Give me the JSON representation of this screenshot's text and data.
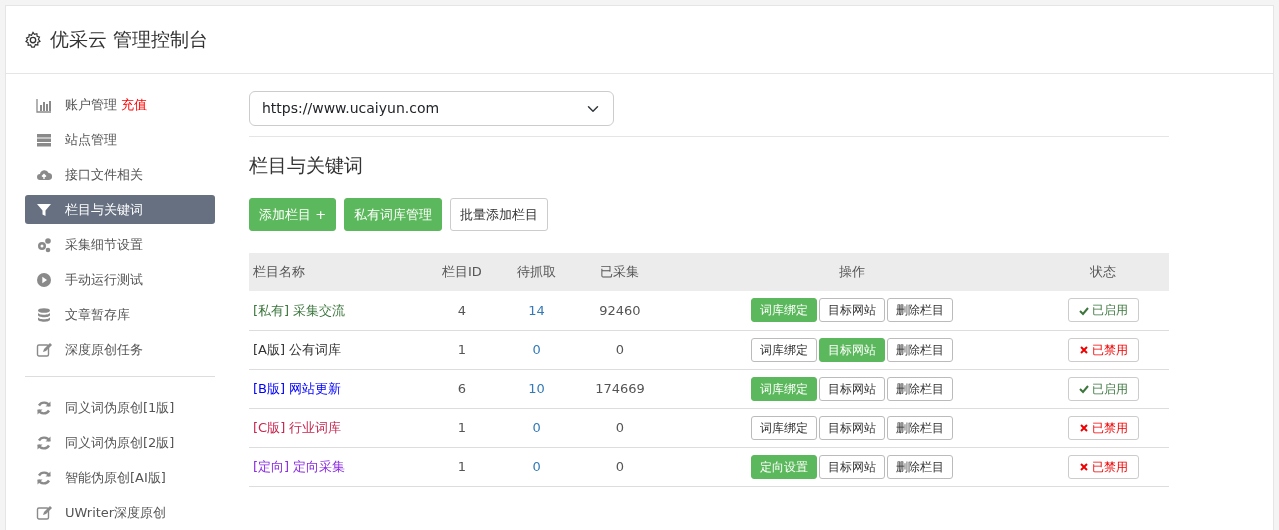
{
  "header": {
    "title": "优采云 管理控制台"
  },
  "sidebar": {
    "groups": [
      [
        {
          "label": "账户管理",
          "badge": "充值",
          "selected": false
        },
        {
          "label": "站点管理",
          "selected": false
        },
        {
          "label": "接口文件相关",
          "selected": false
        },
        {
          "label": "栏目与关键词",
          "selected": true
        },
        {
          "label": "采集细节设置",
          "selected": false
        },
        {
          "label": "手动运行测试",
          "selected": false
        },
        {
          "label": "文章暂存库",
          "selected": false
        },
        {
          "label": "深度原创任务",
          "selected": false
        }
      ],
      [
        {
          "label": "同义词伪原创[1版]",
          "selected": false
        },
        {
          "label": "同义词伪原创[2版]",
          "selected": false
        },
        {
          "label": "智能伪原创[AI版]",
          "selected": false
        },
        {
          "label": "UWriter深度原创",
          "selected": false
        }
      ]
    ]
  },
  "site_select": {
    "value": "https://www.ucaiyun.com"
  },
  "section_title": "栏目与关键词",
  "toolbar": [
    {
      "label": "添加栏目 +",
      "primary": true
    },
    {
      "label": "私有词库管理",
      "primary": true
    },
    {
      "label": "批量添加栏目",
      "primary": false
    }
  ],
  "table": {
    "columns": [
      "栏目名称",
      "栏目ID",
      "待抓取",
      "已采集",
      "操作",
      "状态"
    ],
    "rows": [
      {
        "tag": "[私有]",
        "name": "采集交流",
        "color": "#3c763d",
        "id": "4",
        "pending": "14",
        "collected": "92460",
        "actions": [
          {
            "label": "词库绑定",
            "selected": true
          },
          {
            "label": "目标网站",
            "selected": false
          },
          {
            "label": "删除栏目",
            "selected": false
          }
        ],
        "status": {
          "label": "已启用",
          "enabled": true
        }
      },
      {
        "tag": "[A版]",
        "name": "公有词库",
        "color": "#333333",
        "id": "1",
        "pending": "0",
        "collected": "0",
        "actions": [
          {
            "label": "词库绑定",
            "selected": false
          },
          {
            "label": "目标网站",
            "selected": true
          },
          {
            "label": "删除栏目",
            "selected": false
          }
        ],
        "status": {
          "label": "已禁用",
          "enabled": false
        }
      },
      {
        "tag": "[B版]",
        "name": "网站更新",
        "color": "#0000ff",
        "id": "6",
        "pending": "10",
        "collected": "174669",
        "actions": [
          {
            "label": "词库绑定",
            "selected": true
          },
          {
            "label": "目标网站",
            "selected": false
          },
          {
            "label": "删除栏目",
            "selected": false
          }
        ],
        "status": {
          "label": "已启用",
          "enabled": true
        }
      },
      {
        "tag": "[C版]",
        "name": "行业词库",
        "color": "#c7254e",
        "id": "1",
        "pending": "0",
        "collected": "0",
        "actions": [
          {
            "label": "词库绑定",
            "selected": false
          },
          {
            "label": "目标网站",
            "selected": false
          },
          {
            "label": "删除栏目",
            "selected": false
          }
        ],
        "status": {
          "label": "已禁用",
          "enabled": false
        }
      },
      {
        "tag": "[定向]",
        "name": "定向采集",
        "color": "#8a2be2",
        "id": "1",
        "pending": "0",
        "collected": "0",
        "actions": [
          {
            "label": "定向设置",
            "selected": true
          },
          {
            "label": "目标网站",
            "selected": false
          },
          {
            "label": "删除栏目",
            "selected": false
          }
        ],
        "status": {
          "label": "已禁用",
          "enabled": false
        }
      }
    ]
  }
}
